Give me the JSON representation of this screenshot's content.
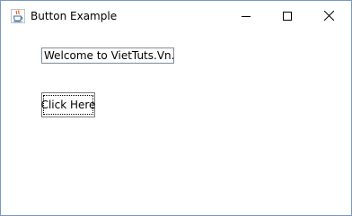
{
  "window": {
    "title": "Button Example",
    "app_icon": "java-coffee-cup-icon",
    "controls": [
      "minimize-icon",
      "maximize-icon",
      "close-icon"
    ],
    "border_color": "#7a98c4"
  },
  "content": {
    "text_field_value": "Welcome to VietTuts.Vn.",
    "button_label": "Click Here"
  }
}
